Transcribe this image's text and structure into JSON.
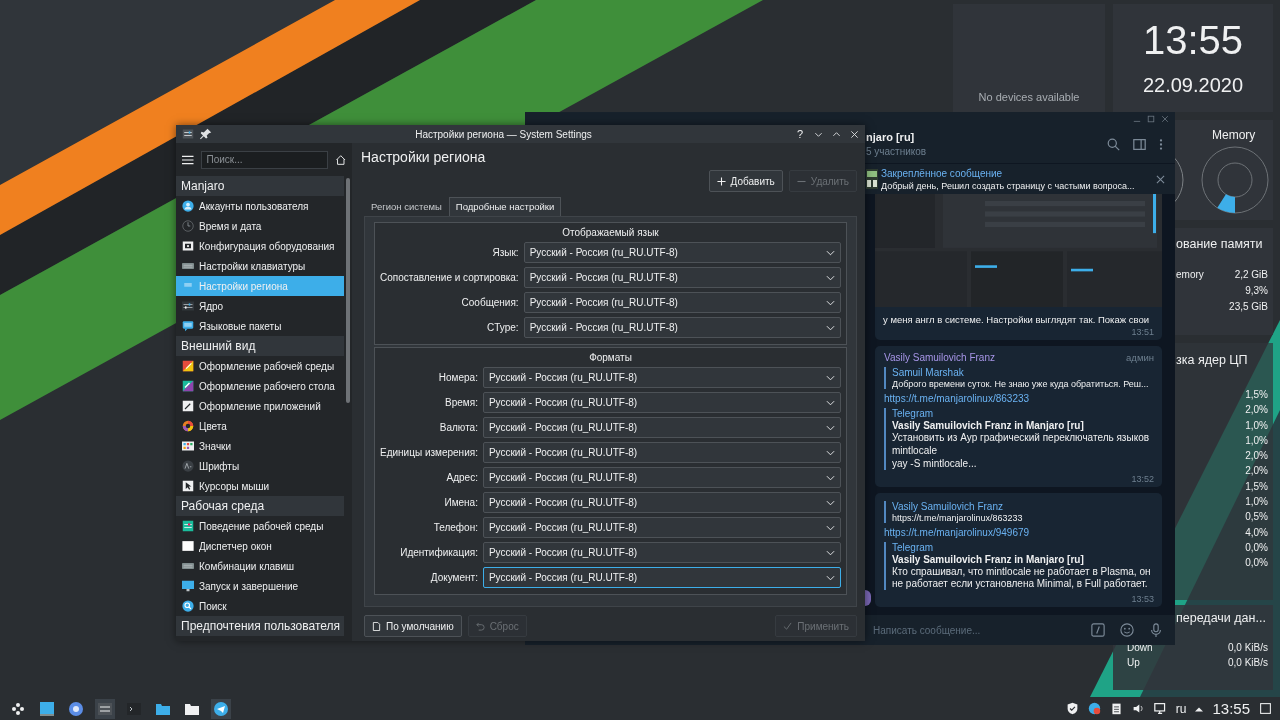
{
  "widgets": {
    "devices": "No devices available",
    "clock": {
      "time": "13:55",
      "date": "22.09.2020"
    },
    "memory_gauge": {
      "title": "Memory"
    },
    "memory_usage": {
      "title": "ование памяти",
      "rows": [
        {
          "label": "emory",
          "value": "2,2 GiB"
        },
        {
          "value": "9,3%"
        },
        {
          "value": "23,5 GiB"
        }
      ]
    },
    "cpu_load": {
      "title": "зка ядер ЦП",
      "values": [
        "1,5%",
        "2,0%",
        "1,0%",
        "1,0%",
        "2,0%",
        "2,0%",
        "1,5%",
        "1,0%",
        "0,5%",
        "4,0%",
        "0,0%",
        "0,0%"
      ]
    },
    "network": {
      "title": "передачи дан...",
      "rows": [
        {
          "label": "Down",
          "value": "0,0 KiB/s"
        },
        {
          "label": "Up",
          "value": "0,0 KiB/s"
        }
      ]
    }
  },
  "telegram_window": {
    "chat_title": "njaro [ru]",
    "members": "5 участников",
    "pinned": {
      "label": "Закреплённое сообщение",
      "text": "Добрый день, Решил создать страницу с частыми вопроса..."
    },
    "messages": [
      {
        "caption": "у меня англ в системе. Настройки выглядят так. Покаж свои",
        "time": "13:51"
      },
      {
        "kind": "text",
        "author": "Vasily Samuilovich Franz",
        "role": "админ",
        "reply": {
          "author": "Samuil Marshak",
          "text": "Доброго времени суток. Не знаю уже куда обратиться. Реш..."
        },
        "link": "https://t.me/manjarolinux/863233",
        "preview": {
          "site": "Telegram",
          "title": "Vasily Samuilovich Franz in Manjaro [ru]",
          "lines": [
            "Установить из Аур графический переключатель языков",
            "mintlocale",
            "yay -S mintlocale..."
          ]
        },
        "time": "13:52"
      },
      {
        "kind": "text",
        "reply": {
          "author": "Vasily Samuilovich Franz",
          "text": "https://t.me/manjarolinux/863233"
        },
        "link": "https://t.me/manjarolinux/949679",
        "preview": {
          "site": "Telegram",
          "title": "Vasily Samuilovich Franz in Manjaro [ru]",
          "lines": [
            "Кто спрашивал, что mintlocale не работает в Plasma, он не работает если установлена Minimal, в Full работает."
          ]
        },
        "time": "13:53"
      }
    ],
    "composer": {
      "placeholder": "Написать сообщение..."
    }
  },
  "settings_window": {
    "title": "Настройки региона — System Settings",
    "help": "?",
    "sidebar": {
      "search_placeholder": "Поиск...",
      "categories": [
        {
          "label": "Manjaro",
          "items": [
            {
              "label": "Аккаунты пользователя",
              "selected": false
            },
            {
              "label": "Время и дата",
              "selected": false
            },
            {
              "label": "Конфигурация оборудования",
              "selected": false
            },
            {
              "label": "Настройки клавиатуры",
              "selected": false
            },
            {
              "label": "Настройки региона",
              "selected": true
            },
            {
              "label": "Ядро",
              "selected": false
            },
            {
              "label": "Языковые пакеты",
              "selected": false
            }
          ]
        },
        {
          "label": "Внешний вид",
          "items": [
            {
              "label": "Оформление рабочей среды",
              "selected": false
            },
            {
              "label": "Оформление рабочего стола",
              "selected": false
            },
            {
              "label": "Оформление приложений",
              "selected": false
            },
            {
              "label": "Цвета",
              "selected": false
            },
            {
              "label": "Значки",
              "selected": false
            },
            {
              "label": "Шрифты",
              "selected": false
            },
            {
              "label": "Курсоры мыши",
              "selected": false
            }
          ]
        },
        {
          "label": "Рабочая среда",
          "items": [
            {
              "label": "Поведение рабочей среды",
              "selected": false
            },
            {
              "label": "Диспетчер окон",
              "selected": false
            },
            {
              "label": "Комбинации клавиш",
              "selected": false
            },
            {
              "label": "Запуск и завершение",
              "selected": false
            },
            {
              "label": "Поиск",
              "selected": false
            }
          ]
        },
        {
          "label": "Предпочтения пользователя"
        }
      ]
    },
    "page": {
      "heading": "Настройки региона",
      "actions": [
        {
          "label": "Добавить",
          "disabled": false
        },
        {
          "label": "Удалить",
          "disabled": true
        }
      ],
      "tabs": [
        {
          "label": "Регион системы",
          "selected": false
        },
        {
          "label": "Подробные настройки",
          "selected": true
        }
      ],
      "groups": [
        {
          "title": "Отображаемый язык",
          "fields": [
            {
              "label": "Язык:",
              "value": "Русский - Россия (ru_RU.UTF-8)",
              "focused": false
            },
            {
              "label": "Сопоставление и сортировка:",
              "value": "Русский - Россия (ru_RU.UTF-8)",
              "focused": false
            },
            {
              "label": "Сообщения:",
              "value": "Русский - Россия (ru_RU.UTF-8)",
              "focused": false
            },
            {
              "label": "CType:",
              "value": "Русский - Россия (ru_RU.UTF-8)",
              "focused": false
            }
          ]
        },
        {
          "title": "Форматы",
          "fields": [
            {
              "label": "Номера:",
              "value": "Русский - Россия (ru_RU.UTF-8)",
              "focused": false
            },
            {
              "label": "Время:",
              "value": "Русский - Россия (ru_RU.UTF-8)",
              "focused": false
            },
            {
              "label": "Валюта:",
              "value": "Русский - Россия (ru_RU.UTF-8)",
              "focused": false
            },
            {
              "label": "Единицы измерения:",
              "value": "Русский - Россия (ru_RU.UTF-8)",
              "focused": false
            },
            {
              "label": "Адрес:",
              "value": "Русский - Россия (ru_RU.UTF-8)",
              "focused": false
            },
            {
              "label": "Имена:",
              "value": "Русский - Россия (ru_RU.UTF-8)",
              "focused": false
            },
            {
              "label": "Телефон:",
              "value": "Русский - Россия (ru_RU.UTF-8)",
              "focused": false
            },
            {
              "label": "Идентификация:",
              "value": "Русский - Россия (ru_RU.UTF-8)",
              "focused": false
            },
            {
              "label": "Документ:",
              "value": "Русский - Россия (ru_RU.UTF-8)",
              "focused": true
            }
          ]
        }
      ],
      "footer": [
        {
          "label": "По умолчанию",
          "disabled": false
        },
        {
          "label": "Сброс",
          "disabled": true
        },
        {
          "label": "Применить",
          "disabled": true
        }
      ]
    }
  },
  "taskbar": {
    "layout": "ru",
    "time": "13:55"
  }
}
